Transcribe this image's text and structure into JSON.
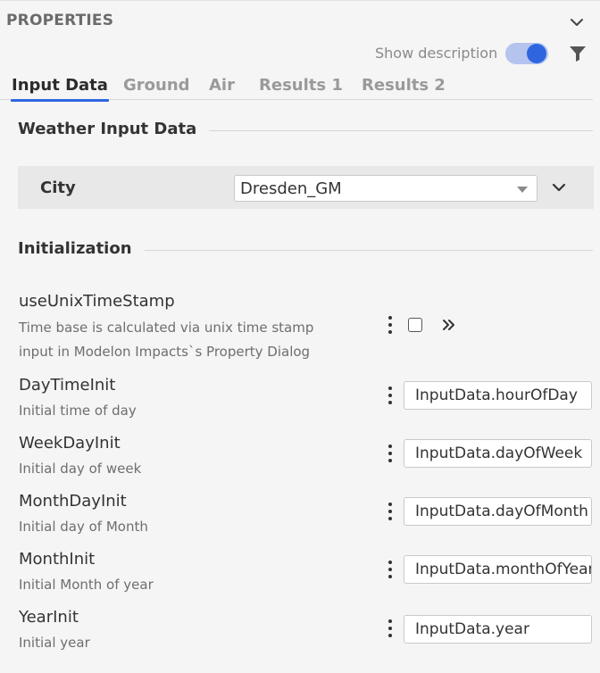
{
  "panel": {
    "title": "PROPERTIES",
    "show_description_label": "Show description",
    "show_description_on": true
  },
  "tabs": [
    {
      "label": "Input Data",
      "active": true
    },
    {
      "label": "Ground",
      "active": false
    },
    {
      "label": "Air",
      "active": false
    },
    {
      "label": "Results 1",
      "active": false
    },
    {
      "label": "Results 2",
      "active": false
    }
  ],
  "weather": {
    "section_title": "Weather Input Data",
    "city_label": "City",
    "city_value": "Dresden_GM"
  },
  "init": {
    "section_title": "Initialization",
    "params": [
      {
        "name": "useUnixTimeStamp",
        "desc_line1": "Time base is calculated via unix time stamp",
        "desc_line2": "input in Modelon Impacts`s Property Dialog",
        "checked": false
      },
      {
        "name": "DayTimeInit",
        "desc": "Initial time of day",
        "value": "InputData.hourOfDay"
      },
      {
        "name": "WeekDayInit",
        "desc": "Initial day of week",
        "value": "InputData.dayOfWeek"
      },
      {
        "name": "MonthDayInit",
        "desc": "Initial day of Month",
        "value": "InputData.dayOfMonth"
      },
      {
        "name": "MonthInit",
        "desc": "Initial Month of year",
        "value": "InputData.monthOfYear"
      },
      {
        "name": "YearInit",
        "desc": "Initial year",
        "value": "InputData.year"
      }
    ]
  },
  "colors": {
    "accent": "#2f66e0",
    "toggle_track": "#b4c4ef",
    "background": "#f5f5f5",
    "row_highlight": "#e8e8e8"
  },
  "icons": {
    "collapse": "chevron-down-icon",
    "filter": "filter-icon",
    "more": "kebab-menu-icon",
    "expand_value": "double-chevron-right-icon"
  }
}
